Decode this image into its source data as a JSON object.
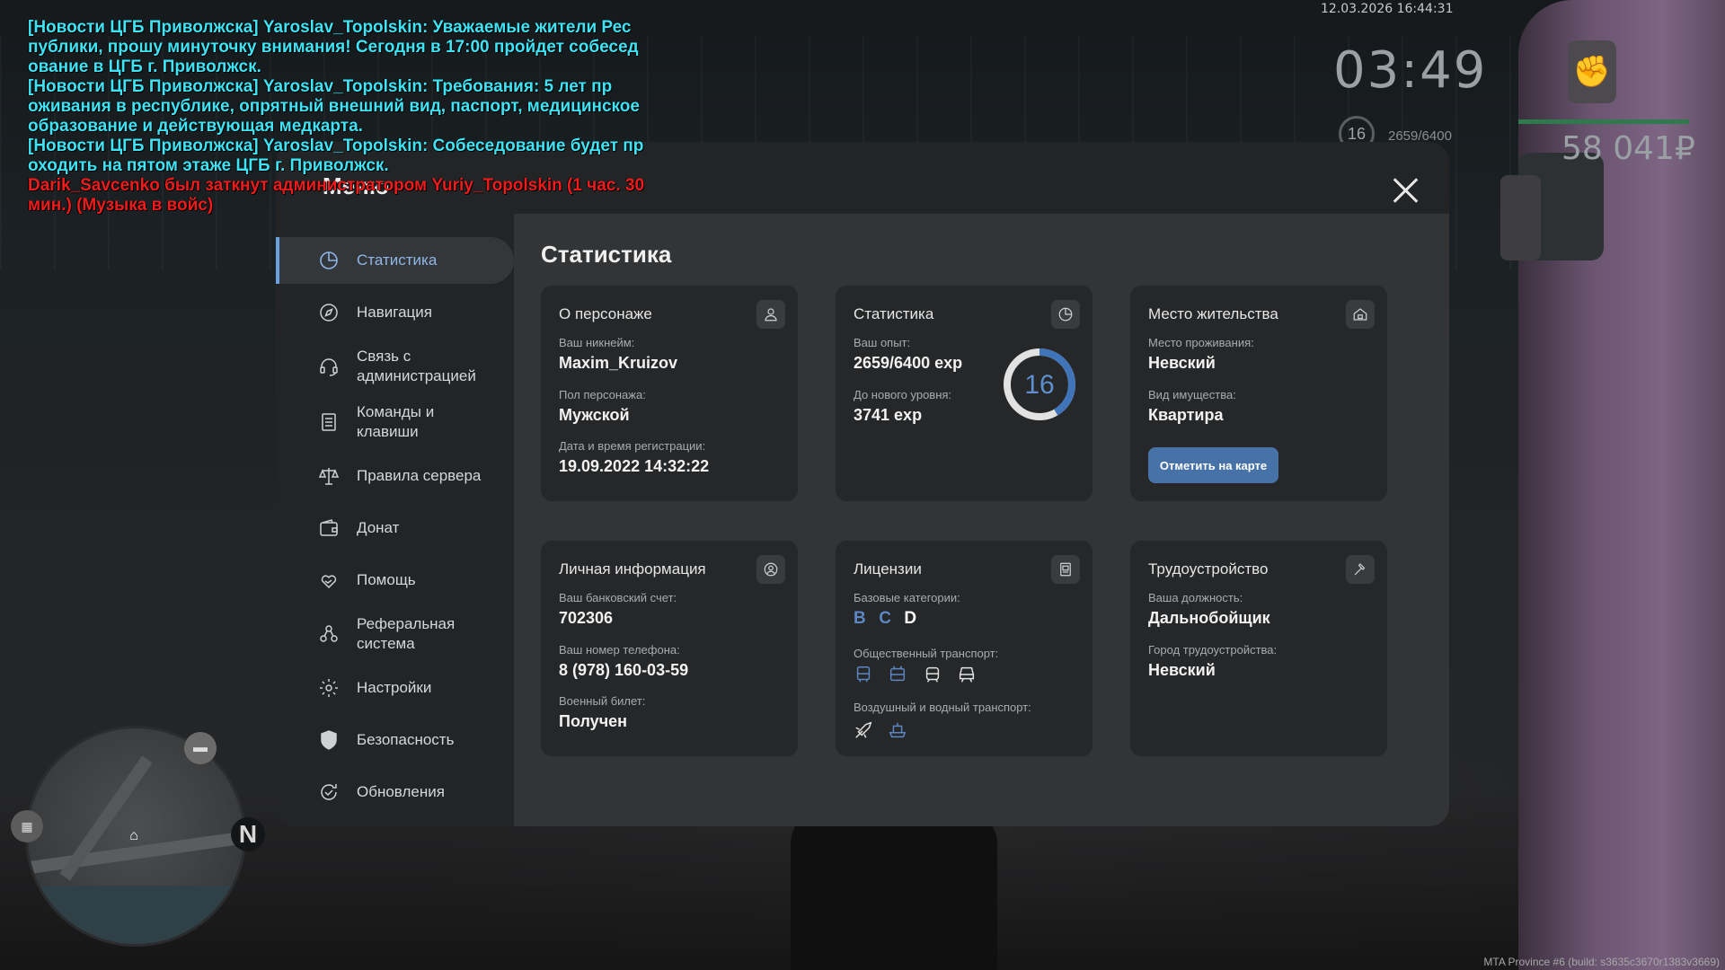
{
  "chat": [
    {
      "text": "[Новости ЦГБ Приволжска] Yaroslav_Topolskin: Уважаемые жители Рес",
      "color": "cyan"
    },
    {
      "text": "публики, прошу минуточку внимания! Сегодня в 17:00 пройдет собесед",
      "color": "cyan"
    },
    {
      "text": "ование в ЦГБ г. Приволжск.",
      "color": "cyan"
    },
    {
      "text": "[Новости ЦГБ Приволжска] Yaroslav_Topolskin: Требования: 5 лет пр",
      "color": "cyan"
    },
    {
      "text": "оживания в республике, опрятный внешний вид, паспорт, медицинское",
      "color": "cyan"
    },
    {
      "text": "образование и действующая медкарта.",
      "color": "cyan"
    },
    {
      "text": "[Новости ЦГБ Приволжска] Yaroslav_Topolskin: Собеседование будет пр",
      "color": "cyan"
    },
    {
      "text": "оходить на пятом этаже ЦГБ г. Приволжск.",
      "color": "cyan"
    },
    {
      "text": "Darik_Savcenko был заткнут администратором Yuriy_Topolskin (1 час. 30",
      "color": "red"
    },
    {
      "text": "мин.) (Музыка в войс)",
      "color": "red"
    }
  ],
  "hud": {
    "datetime": "12.03.2026 16:44:31",
    "clock": "03:49",
    "level": "16",
    "exp": "2659/6400",
    "money": "58 041₽",
    "build": "MTA Province #6 (build: s3635c3670r1383v3669)"
  },
  "menu": {
    "title": "Меню",
    "content_title": "Статистика",
    "nav": [
      {
        "label": "Статистика",
        "icon": "pie-chart-icon",
        "active": true
      },
      {
        "label": "Навигация",
        "icon": "compass-icon"
      },
      {
        "label": "Связь с\nадминистрацией",
        "icon": "headset-icon"
      },
      {
        "label": "Команды и\nклавиши",
        "icon": "document-icon"
      },
      {
        "label": "Правила сервера",
        "icon": "scales-icon"
      },
      {
        "label": "Донат",
        "icon": "wallet-icon"
      },
      {
        "label": "Помощь",
        "icon": "heart-hand-icon"
      },
      {
        "label": "Реферальная\nсистема",
        "icon": "people-network-icon"
      },
      {
        "label": "Настройки",
        "icon": "gear-icon"
      },
      {
        "label": "Безопасность",
        "icon": "shield-icon"
      },
      {
        "label": "Обновления",
        "icon": "refresh-check-icon"
      }
    ]
  },
  "cards": {
    "character": {
      "title": "О персонаже",
      "nickname_label": "Ваш никнейм:",
      "nickname": "Maxim_Kruizov",
      "gender_label": "Пол персонажа:",
      "gender": "Мужской",
      "reg_label": "Дата и время регистрации:",
      "reg": "19.09.2022 14:32:22"
    },
    "stats": {
      "title": "Статистика",
      "exp_label": "Ваш опыт:",
      "exp": "2659/6400 exp",
      "next_label": "До нового уровня:",
      "next": "3741 exp",
      "level": "16",
      "progress": 0.415
    },
    "residence": {
      "title": "Место жительства",
      "place_label": "Место проживания:",
      "place": "Невский",
      "property_label": "Вид имущества:",
      "property": "Квартира",
      "button": "Отметить на карте"
    },
    "personal": {
      "title": "Личная информация",
      "bank_label": "Ваш банковский счет:",
      "bank": "702306",
      "phone_label": "Ваш номер телефона:",
      "phone": "8 (978) 160-03-59",
      "military_label": "Военный билет:",
      "military": "Получен"
    },
    "licenses": {
      "title": "Лицензии",
      "base_label": "Базовые категории:",
      "categories": [
        {
          "name": "B",
          "owned": false,
          "color": "#5d86c4"
        },
        {
          "name": "C",
          "owned": false,
          "color": "#5d86c4"
        },
        {
          "name": "D",
          "owned": true,
          "color": "#ffffff"
        }
      ],
      "public_label": "Общественный транспорт:",
      "public_icons": [
        "bus-icon",
        "trolleybus-icon",
        "tram-icon",
        "train-icon"
      ],
      "air_label": "Воздушный и водный транспорт:",
      "air_icons": [
        "plane-icon",
        "boat-icon"
      ]
    },
    "job": {
      "title": "Трудоустройство",
      "position_label": "Ваша должность:",
      "position": "Дальнобойщик",
      "city_label": "Город трудоустройства:",
      "city": "Невский"
    }
  }
}
